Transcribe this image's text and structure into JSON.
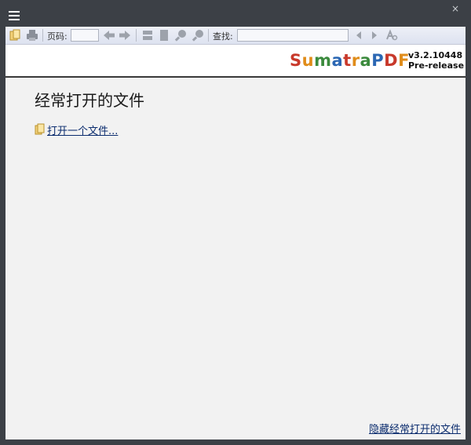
{
  "toolbar": {
    "page_label": "页码:",
    "page_value": "",
    "find_label": "查找:",
    "find_value": ""
  },
  "banner": {
    "logo_parts": [
      "S",
      "u",
      "m",
      "a",
      "t",
      "r",
      "a",
      "P",
      "D",
      "F"
    ],
    "logo_colors": [
      "#c8392b",
      "#e08c1a",
      "#3b8a3d",
      "#2b67b3",
      "#c8392b",
      "#e08c1a",
      "#3b8a3d",
      "#2b67b3",
      "#c8392b",
      "#e08c1a"
    ],
    "version": "v3.2.10448",
    "build": "Pre-release"
  },
  "main": {
    "heading": "经常打开的文件",
    "open_file_link": "打开一个文件...",
    "hide_link": "隐藏经常打开的文件"
  },
  "window": {
    "close_glyph": "×"
  }
}
